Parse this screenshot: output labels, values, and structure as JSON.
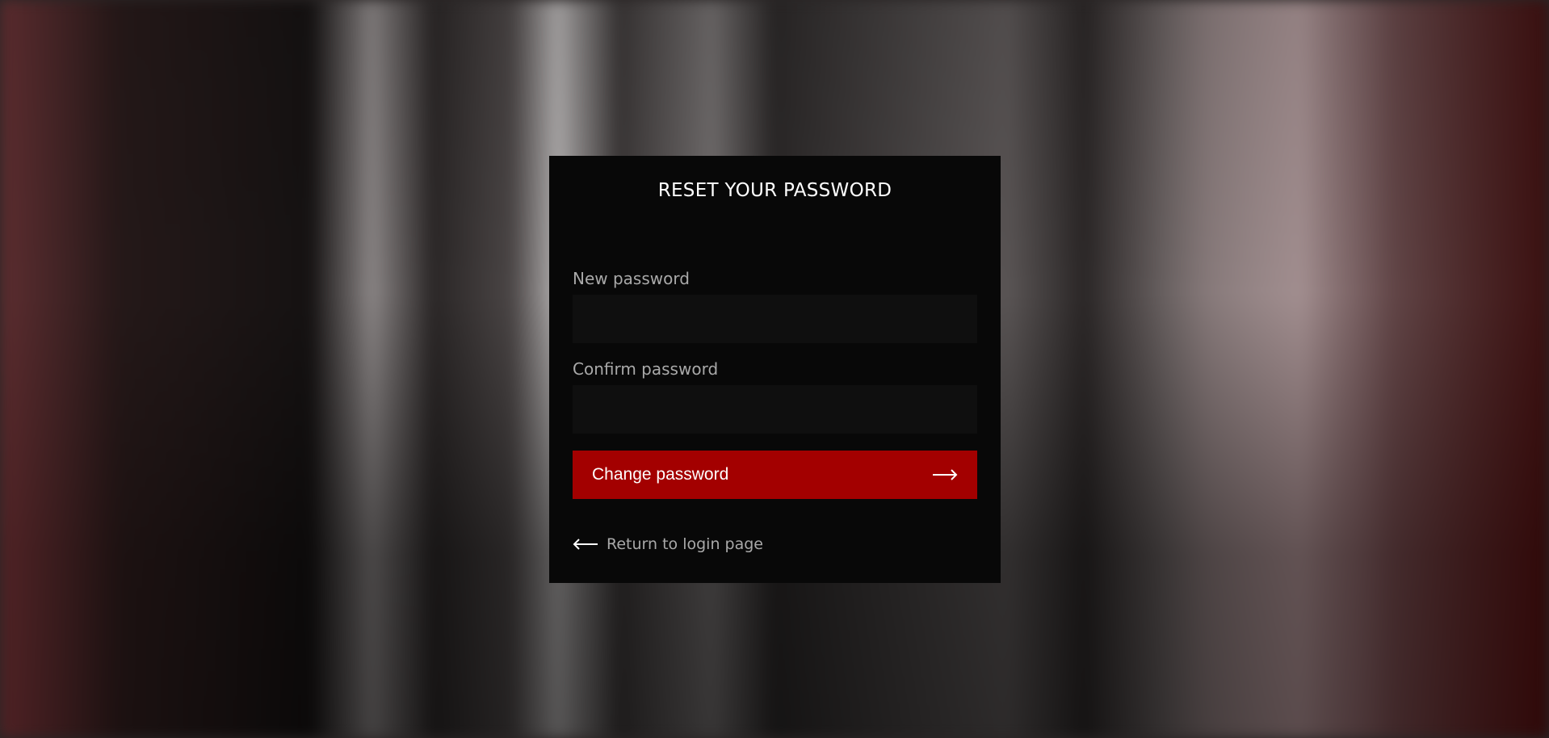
{
  "form": {
    "title": "RESET YOUR PASSWORD",
    "new_password_label": "New password",
    "new_password_value": "",
    "confirm_password_label": "Confirm password",
    "confirm_password_value": "",
    "submit_label": "Change password",
    "submit_icon": "arrow-right-icon",
    "back_label": "Return to login page",
    "back_icon": "arrow-left-icon"
  },
  "colors": {
    "accent": "#a30000",
    "card": "#080808",
    "input": "#0f0f0f"
  }
}
